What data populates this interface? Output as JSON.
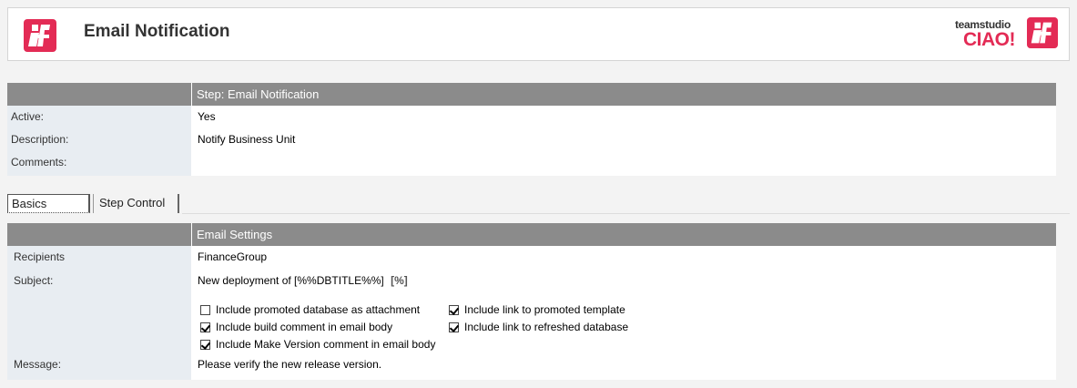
{
  "header": {
    "title": "Email Notification",
    "brand_small": "teamstudio",
    "brand_big": "CIAO!",
    "brand_color": "#e32b55"
  },
  "step": {
    "heading": "Step:  Email Notification",
    "active_label": "Active:",
    "active_value": "Yes",
    "description_label": "Description:",
    "description_value": "Notify Business Unit",
    "comments_label": "Comments:",
    "comments_value": ""
  },
  "tabs": [
    {
      "label": "Basics",
      "selected": true
    },
    {
      "label": "Step Control",
      "selected": false
    }
  ],
  "email": {
    "heading": "Email Settings",
    "recipients_label": "Recipients",
    "recipients_value": "FinanceGroup",
    "subject_label": "Subject:",
    "subject_value": "New deployment of [%%DBTITLE%%]",
    "subject_tag_button": "[%]",
    "options": [
      {
        "label": "Include promoted database as attachment",
        "checked": false
      },
      {
        "label": "Include build comment in email body",
        "checked": true
      },
      {
        "label": "Include Make Version comment in email body",
        "checked": true
      },
      {
        "label": "Include link to promoted template",
        "checked": true
      },
      {
        "label": "Include link to refreshed database",
        "checked": true
      }
    ],
    "message_label": "Message:",
    "message_value": "Please verify the new release version."
  }
}
